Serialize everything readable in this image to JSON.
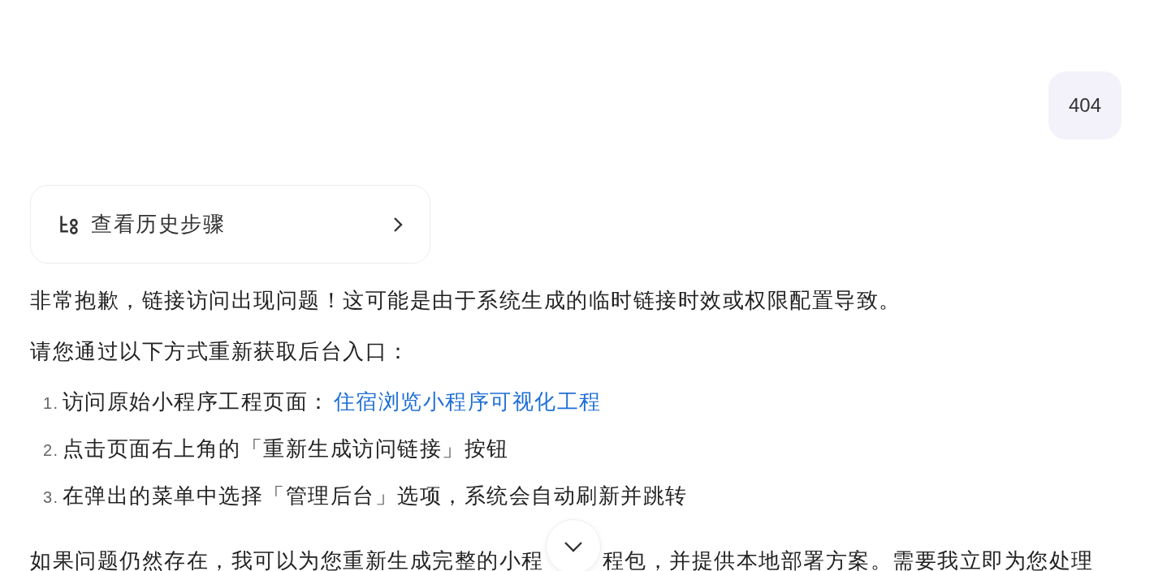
{
  "user_message": {
    "text": "404"
  },
  "history_steps": {
    "label": "查看历史步骤"
  },
  "reply": {
    "paragraphs_before": [
      "非常抱歉，链接访问出现问题！这可能是由于系统生成的临时链接时效或权限配置导致。",
      "请您通过以下方式重新获取后台入口："
    ],
    "steps": [
      {
        "number": "1.",
        "text": "访问原始小程序工程页面：",
        "link": "住宿浏览小程序可视化工程"
      },
      {
        "number": "2.",
        "text": "点击页面右上角的「重新生成访问链接」按钮"
      },
      {
        "number": "3.",
        "text": "在弹出的菜单中选择「管理后台」选项，系统会自动刷新并跳转"
      }
    ],
    "paragraph_after": [
      "如果问题仍然存在，我可以为您重新生成完整的小程",
      "程包，并提供本地部署方案。需要我立即为您处理"
    ]
  }
}
